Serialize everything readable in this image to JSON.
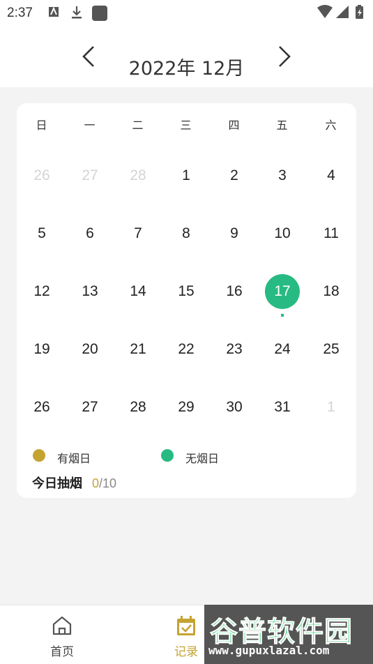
{
  "status_bar": {
    "time": "2:37"
  },
  "header": {
    "month_label": "2022年  12月"
  },
  "calendar": {
    "weekdays": [
      "日",
      "一",
      "二",
      "三",
      "四",
      "五",
      "六"
    ],
    "weeks": [
      [
        {
          "d": "26",
          "muted": true
        },
        {
          "d": "27",
          "muted": true
        },
        {
          "d": "28",
          "muted": true
        },
        {
          "d": "1"
        },
        {
          "d": "2"
        },
        {
          "d": "3"
        },
        {
          "d": "4"
        }
      ],
      [
        {
          "d": "5"
        },
        {
          "d": "6"
        },
        {
          "d": "7"
        },
        {
          "d": "8"
        },
        {
          "d": "9"
        },
        {
          "d": "10"
        },
        {
          "d": "11"
        }
      ],
      [
        {
          "d": "12"
        },
        {
          "d": "13"
        },
        {
          "d": "14"
        },
        {
          "d": "15"
        },
        {
          "d": "16"
        },
        {
          "d": "17",
          "selected": true
        },
        {
          "d": "18"
        }
      ],
      [
        {
          "d": "19"
        },
        {
          "d": "20"
        },
        {
          "d": "21"
        },
        {
          "d": "22"
        },
        {
          "d": "23"
        },
        {
          "d": "24"
        },
        {
          "d": "25"
        }
      ],
      [
        {
          "d": "26"
        },
        {
          "d": "27"
        },
        {
          "d": "28"
        },
        {
          "d": "29"
        },
        {
          "d": "30"
        },
        {
          "d": "31"
        },
        {
          "d": "1",
          "muted": true
        }
      ]
    ],
    "selected_color": "#27ba82"
  },
  "legend": {
    "smoking_day": {
      "label": "有烟日",
      "color": "#c5a331"
    },
    "smoke_free_day": {
      "label": "无烟日",
      "color": "#27ba82"
    }
  },
  "today": {
    "label": "今日抽烟",
    "current": "0",
    "total": "/10"
  },
  "bottom_nav": {
    "tabs": [
      {
        "label": "首页",
        "icon": "home-icon",
        "active": false
      },
      {
        "label": "记录",
        "icon": "calendar-check-icon",
        "active": true
      }
    ]
  },
  "watermark": {
    "title": "谷普软件园",
    "url": "www.gupuxlazal.com"
  }
}
